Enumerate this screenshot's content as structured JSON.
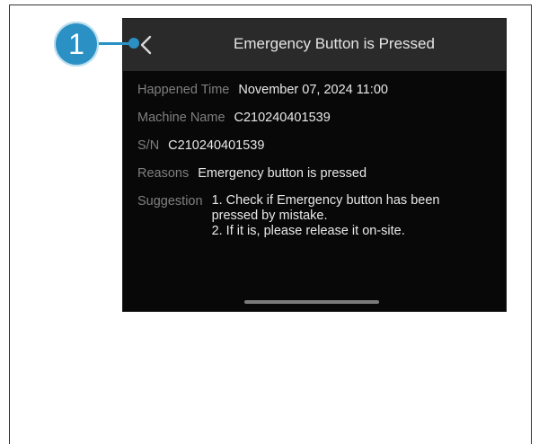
{
  "callout": {
    "number": "1"
  },
  "screen": {
    "title": "Emergency Button is Pressed",
    "details": [
      {
        "label": "Happened Time",
        "value": "November 07, 2024 11:00"
      },
      {
        "label": "Machine Name",
        "value": "C210240401539"
      },
      {
        "label": "S/N",
        "value": "C210240401539"
      },
      {
        "label": "Reasons",
        "value": "Emergency button is pressed"
      }
    ],
    "suggestion": {
      "label": "Suggestion",
      "lines": [
        "1. Check if Emergency button has been",
        "pressed by mistake.",
        "2. If it is, please release it on-site."
      ]
    }
  },
  "colors": {
    "callout": "#2b91c4",
    "screen_bg": "#080808",
    "header_bg": "#2a2a2a",
    "label": "#7f7f7f",
    "value": "#e8e8e8"
  },
  "icons": {
    "back": "chevron-left-icon"
  }
}
